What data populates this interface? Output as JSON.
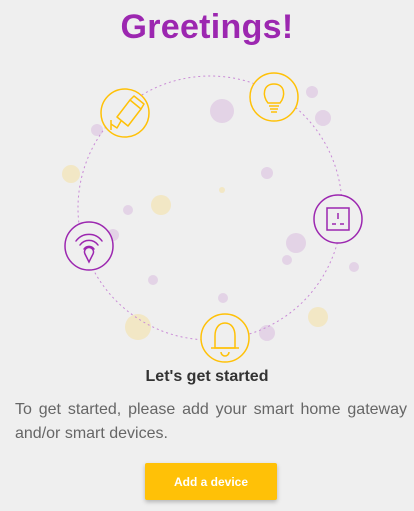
{
  "header": {
    "title": "Greetings!"
  },
  "colors": {
    "primary": "#9c27b0",
    "accent": "#ffc107"
  },
  "icons": [
    "security-camera-icon",
    "light-bulb-icon",
    "power-socket-icon",
    "alarm-bell-icon",
    "wifi-location-icon"
  ],
  "content": {
    "heading": "Let's get started",
    "message": "To get started, please add your smart home gateway and/or smart devices."
  },
  "actions": {
    "add_device_label": "Add a device"
  }
}
